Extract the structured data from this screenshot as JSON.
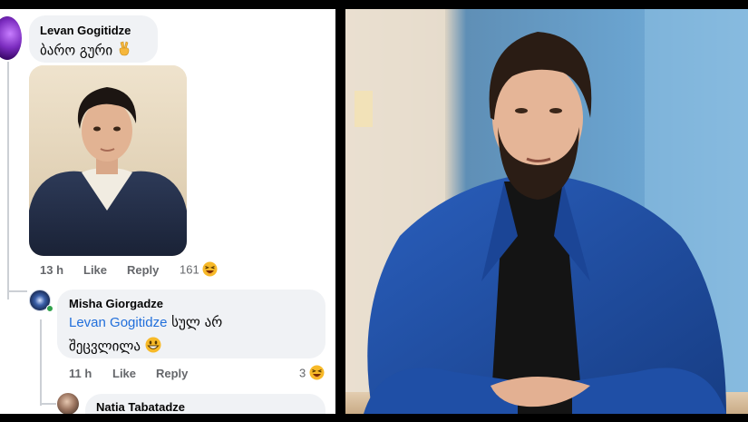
{
  "comments": {
    "levan": {
      "author": "Levan Gogitidze",
      "text": "ბარო გური",
      "emoji": "✌️",
      "time": "13 h",
      "like": "Like",
      "reply": "Reply",
      "reaction_count": "161",
      "reaction_icon": "laughing-emoji-icon"
    },
    "misha": {
      "author": "Misha Giorgadze",
      "mention": "Levan Gogitidze",
      "text_line1": " სულ არ",
      "text_line2": "შეცვლილა",
      "emoji": "grinning-emoji-icon",
      "time": "11 h",
      "like": "Like",
      "reply": "Reply",
      "reaction_count": "3",
      "reaction_icon": "laughing-emoji-icon"
    },
    "natia": {
      "author": "Natia Tabatadze"
    }
  },
  "colors": {
    "mention": "#216fdb",
    "bubble": "#f0f2f5",
    "meta": "#65676b",
    "online": "#31a24c",
    "jacket": "#1f4fa6"
  }
}
